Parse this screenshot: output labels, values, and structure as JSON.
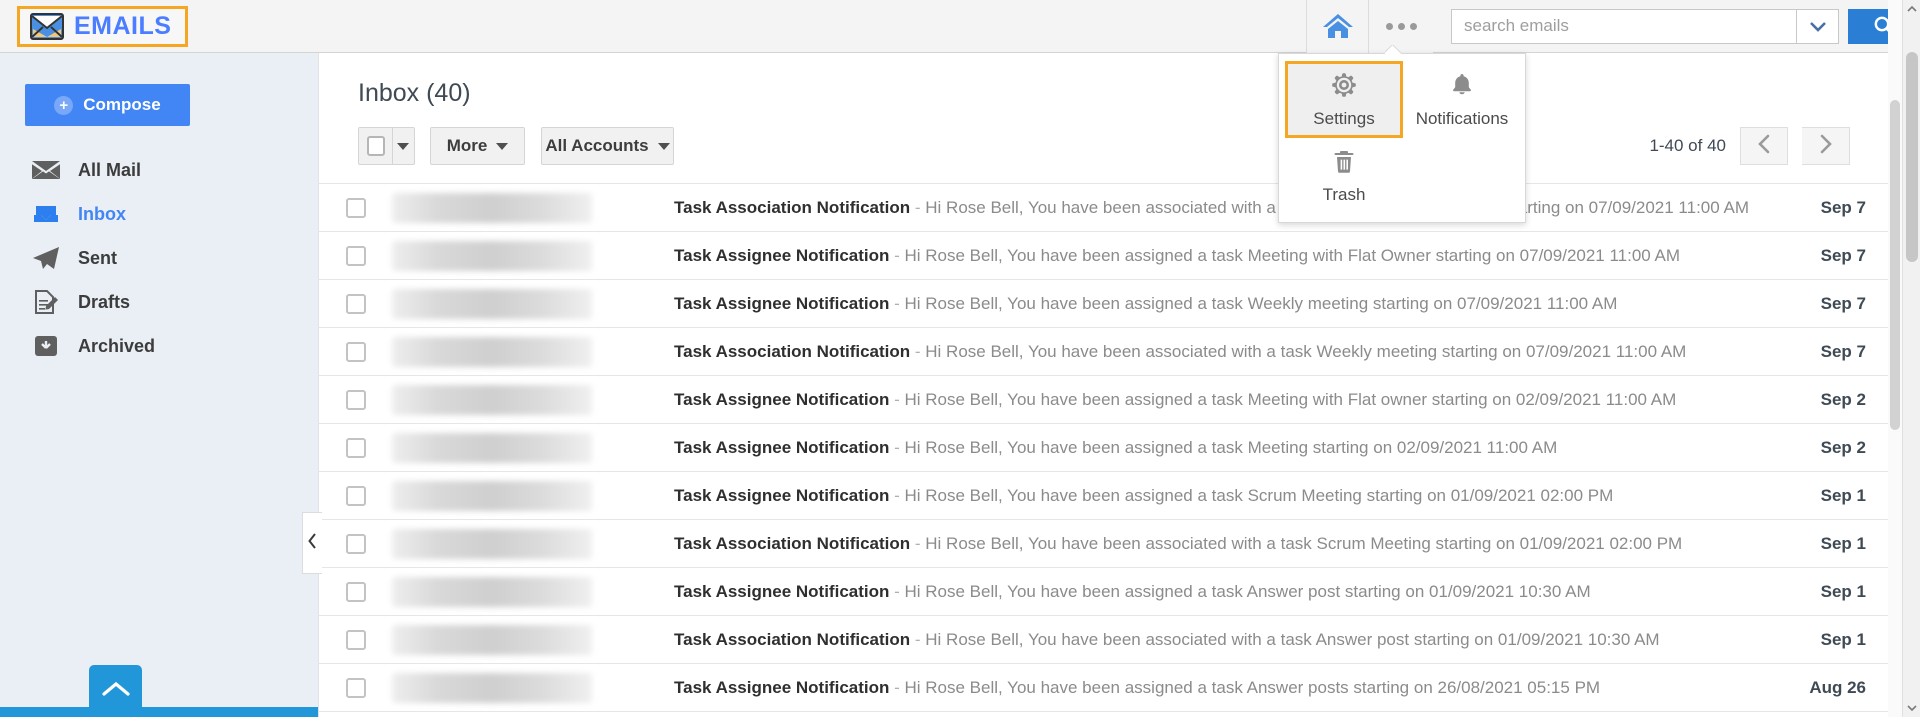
{
  "brand": {
    "name": "EMAILS",
    "logo_icon": "envelope-icon",
    "accent": "#4a7dff",
    "highlight": "#f5a623"
  },
  "topbar": {
    "home_icon": "home-icon",
    "menu_icon": "three-dots-icon",
    "search": {
      "value": "",
      "placeholder": "search emails"
    },
    "search_caret_icon": "chevron-down-icon",
    "search_button_icon": "search-icon"
  },
  "menu": {
    "items": [
      {
        "label": "Settings",
        "icon": "gear-icon",
        "selected": true
      },
      {
        "label": "Notifications",
        "icon": "bell-icon",
        "selected": false
      },
      {
        "label": "Trash",
        "icon": "trash-icon",
        "selected": false
      }
    ]
  },
  "sidebar": {
    "compose_label": "Compose",
    "compose_icon": "plus-circle-icon",
    "items": [
      {
        "label": "All Mail",
        "icon": "envelope-icon",
        "active": false
      },
      {
        "label": "Inbox",
        "icon": "inbox-download-icon",
        "active": true
      },
      {
        "label": "Sent",
        "icon": "paper-plane-icon",
        "active": false
      },
      {
        "label": "Drafts",
        "icon": "document-pencil-icon",
        "active": false
      },
      {
        "label": "Archived",
        "icon": "archive-box-icon",
        "active": false
      }
    ],
    "scroll_top_icon": "chevron-up-icon",
    "collapse_icon": "chevron-left-icon"
  },
  "main": {
    "title": "Inbox (40)",
    "toolbar": {
      "select_all_checked": false,
      "select_all_caret_icon": "caret-down-icon",
      "more_label": "More",
      "accounts_label": "All Accounts"
    },
    "pager": {
      "count_label": "1-40 of 40",
      "prev_icon": "chevron-left-icon",
      "next_icon": "chevron-right-icon"
    },
    "emails": [
      {
        "subject": "Task Association Notification",
        "preview": "Hi Rose Bell, You have been associated with a task Meeting with Flat Owner starting on 07/09/2021 11:00 AM",
        "date": "Sep 7"
      },
      {
        "subject": "Task Assignee Notification",
        "preview": "Hi Rose Bell, You have been assigned a task Meeting with Flat Owner starting on 07/09/2021 11:00 AM",
        "date": "Sep 7"
      },
      {
        "subject": "Task Assignee Notification",
        "preview": "Hi Rose Bell, You have been assigned a task Weekly meeting starting on 07/09/2021 11:00 AM",
        "date": "Sep 7"
      },
      {
        "subject": "Task Association Notification",
        "preview": "Hi Rose Bell, You have been associated with a task Weekly meeting starting on 07/09/2021 11:00 AM",
        "date": "Sep 7"
      },
      {
        "subject": "Task Assignee Notification",
        "preview": "Hi Rose Bell, You have been assigned a task Meeting with Flat owner starting on 02/09/2021 11:00 AM",
        "date": "Sep 2"
      },
      {
        "subject": "Task Assignee Notification",
        "preview": "Hi Rose Bell, You have been assigned a task Meeting starting on 02/09/2021 11:00 AM",
        "date": "Sep 2"
      },
      {
        "subject": "Task Assignee Notification",
        "preview": "Hi Rose Bell, You have been assigned a task Scrum Meeting starting on 01/09/2021 02:00 PM",
        "date": "Sep 1"
      },
      {
        "subject": "Task Association Notification",
        "preview": "Hi Rose Bell, You have been associated with a task Scrum Meeting starting on 01/09/2021 02:00 PM",
        "date": "Sep 1"
      },
      {
        "subject": "Task Assignee Notification",
        "preview": "Hi Rose Bell, You have been assigned a task Answer post starting on 01/09/2021 10:30 AM",
        "date": "Sep 1"
      },
      {
        "subject": "Task Association Notification",
        "preview": "Hi Rose Bell, You have been associated with a task Answer post starting on 01/09/2021 10:30 AM",
        "date": "Sep 1"
      },
      {
        "subject": "Task Assignee Notification",
        "preview": "Hi Rose Bell, You have been assigned a task Answer posts starting on 26/08/2021 05:15 PM",
        "date": "Aug 26"
      }
    ]
  }
}
